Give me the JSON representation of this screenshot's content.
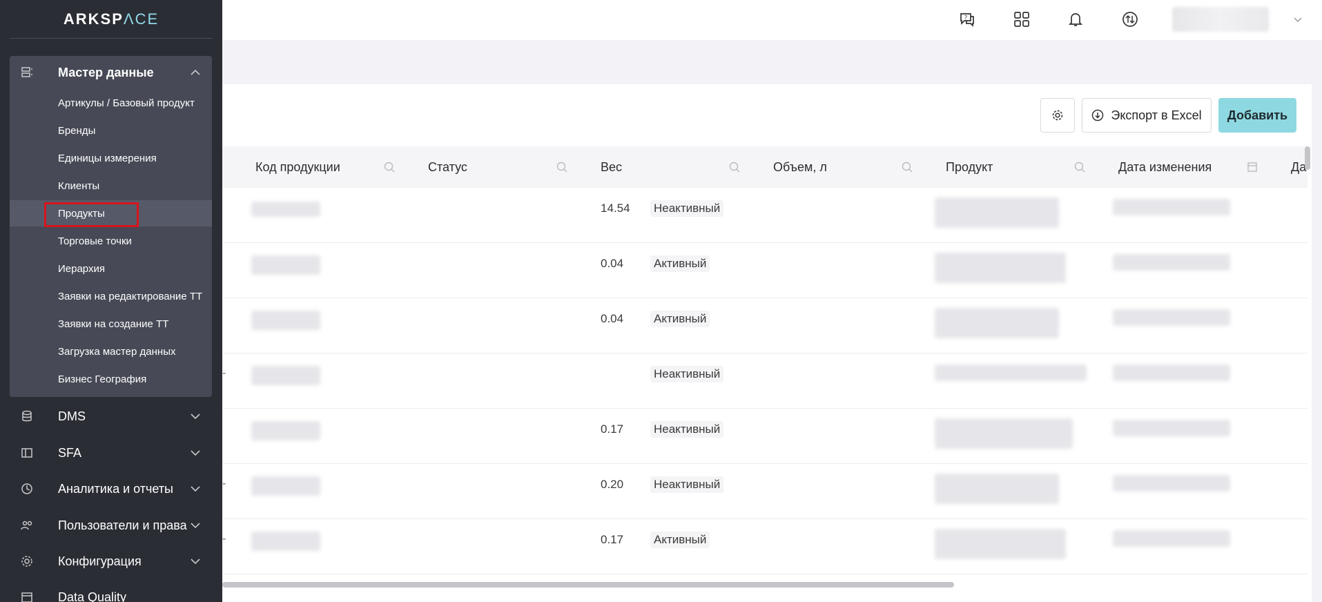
{
  "brand": {
    "logo_bold": "ARKSP",
    "logo_thin": "ΛCE"
  },
  "sidebar": {
    "master_group": {
      "label": "Мастер данные",
      "icon": "database-list-icon"
    },
    "sub_items": [
      {
        "label": "Артикулы / Базовый продукт"
      },
      {
        "label": "Бренды"
      },
      {
        "label": "Единицы измерения"
      },
      {
        "label": "Клиенты"
      },
      {
        "label": "Продукты",
        "active": true
      },
      {
        "label": "Торговые точки"
      },
      {
        "label": "Иерархия"
      },
      {
        "label": "Заявки на редактирование ТТ"
      },
      {
        "label": "Заявки на создание ТТ"
      },
      {
        "label": "Загрузка мастер данных"
      },
      {
        "label": "Бизнес География"
      }
    ],
    "groups": [
      {
        "label": "DMS",
        "icon": "database-icon"
      },
      {
        "label": "SFA",
        "icon": "layout-icon"
      },
      {
        "label": "Аналитика и отчеты",
        "icon": "pie-chart-icon"
      },
      {
        "label": "Пользователи и права",
        "icon": "users-icon"
      },
      {
        "label": "Конфигурация",
        "icon": "gear-icon"
      },
      {
        "label": "Data Quality",
        "icon": "calendar-icon"
      }
    ]
  },
  "header": {
    "icons": [
      "help-chat-icon",
      "apps-grid-icon",
      "bell-icon",
      "sync-icon"
    ]
  },
  "toolbar": {
    "export_label": "Экспорт в Excel",
    "add_label": "Добавить"
  },
  "table": {
    "columns": [
      {
        "label": "Код продукции"
      },
      {
        "label": "Статус"
      },
      {
        "label": "Вес"
      },
      {
        "label": "Объем, л"
      },
      {
        "label": "Продукт"
      },
      {
        "label": "Дата изменения"
      },
      {
        "label": "Да"
      }
    ],
    "rows": [
      {
        "status": "Неактивный",
        "weight": "14.54",
        "prefix": ""
      },
      {
        "status": "Активный",
        "weight": "0.04",
        "prefix": ""
      },
      {
        "status": "Активный",
        "weight": "0.04",
        "prefix": ""
      },
      {
        "status": "Неактивный",
        "weight": "",
        "prefix": "-"
      },
      {
        "status": "Неактивный",
        "weight": "0.17",
        "prefix": ""
      },
      {
        "status": "Неактивный",
        "weight": "0.20",
        "prefix": "-"
      },
      {
        "status": "Активный",
        "weight": "0.17",
        "prefix": "-"
      }
    ]
  },
  "colors": {
    "sidebar_bg": "#2b2d35",
    "accent": "#8ed9e1",
    "highlight": "#d8141c"
  }
}
